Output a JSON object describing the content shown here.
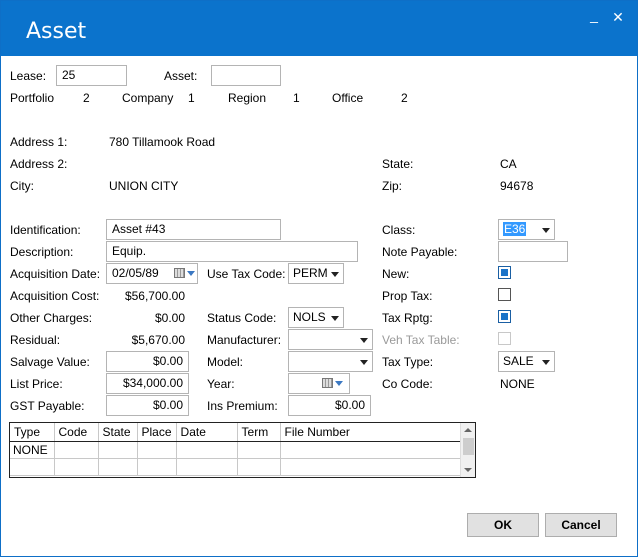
{
  "window": {
    "title": "Asset",
    "minimize_glyph": "_",
    "close_glyph": "✕"
  },
  "header": {
    "lease_label": "Lease:",
    "lease_value": "25",
    "asset_label": "Asset:",
    "asset_value": "",
    "portfolio_label": "Portfolio",
    "portfolio_value": "2",
    "company_label": "Company",
    "company_value": "1",
    "region_label": "Region",
    "region_value": "1",
    "office_label": "Office",
    "office_value": "2"
  },
  "address": {
    "address1_label": "Address 1:",
    "address1_value": "780 Tillamook Road",
    "address2_label": "Address 2:",
    "address2_value": "",
    "city_label": "City:",
    "city_value": "UNION CITY",
    "state_label": "State:",
    "state_value": "CA",
    "zip_label": "Zip:",
    "zip_value": "94678"
  },
  "details": {
    "identification_label": "Identification:",
    "identification_value": "Asset #43",
    "description_label": "Description:",
    "description_value": "Equip.",
    "acq_date_label": "Acquisition Date:",
    "acq_date_value": "02/05/89",
    "acq_cost_label": "Acquisition Cost:",
    "acq_cost_value": "$56,700.00",
    "other_charges_label": "Other Charges:",
    "other_charges_value": "$0.00",
    "residual_label": "Residual:",
    "residual_value": "$5,670.00",
    "salvage_label": "Salvage Value:",
    "salvage_value": "$0.00",
    "list_price_label": "List Price:",
    "list_price_value": "$34,000.00",
    "gst_label": "GST Payable:",
    "gst_value": "$0.00",
    "use_tax_label": "Use Tax Code:",
    "use_tax_value": "PERM",
    "status_label": "Status Code:",
    "status_value": "NOLS",
    "manufacturer_label": "Manufacturer:",
    "manufacturer_value": "",
    "model_label": "Model:",
    "model_value": "",
    "year_label": "Year:",
    "year_value": "",
    "ins_label": "Ins Premium:",
    "ins_value": "$0.00",
    "class_label": "Class:",
    "class_value": "E36",
    "note_label": "Note Payable:",
    "note_value": "",
    "new_label": "New:",
    "new_checked": true,
    "prop_tax_label": "Prop Tax:",
    "prop_tax_checked": false,
    "tax_rptg_label": "Tax Rptg:",
    "tax_rptg_checked": true,
    "veh_label": "Veh Tax Table:",
    "veh_checked": false,
    "tax_type_label": "Tax Type:",
    "tax_type_value": "SALE",
    "co_code_label": "Co Code:",
    "co_code_value": "NONE"
  },
  "grid": {
    "columns": [
      "Type",
      "Code",
      "State",
      "Place",
      "Date",
      "Term",
      "File Number"
    ],
    "rows": [
      [
        "NONE",
        "",
        "",
        "",
        "",
        "",
        ""
      ],
      [
        "",
        "",
        "",
        "",
        "",
        "",
        ""
      ]
    ]
  },
  "buttons": {
    "ok": "OK",
    "cancel": "Cancel"
  },
  "colors": {
    "titlebar": "#0b73cc",
    "accent": "#1a73c8",
    "selection": "#3399ff"
  }
}
